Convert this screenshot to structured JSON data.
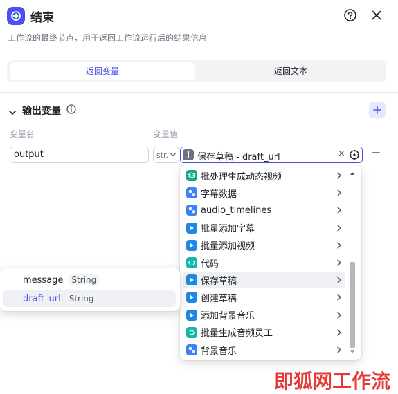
{
  "header": {
    "title": "结束",
    "subtitle": "工作流的最终节点，用于返回工作流运行后的结果信息",
    "accent": "#4d53e8"
  },
  "tabs": [
    {
      "label": "返回变量",
      "active": true
    },
    {
      "label": "返回文本",
      "active": false
    }
  ],
  "output_section": {
    "title": "输出变量",
    "col_name_label": "变量名",
    "col_value_label": "变量值",
    "row": {
      "name_value": "output",
      "type_value": "str.",
      "ref_value": "保存草稿 - draft_url"
    }
  },
  "dropdown": {
    "items": [
      {
        "label": "批处理生成动态视频",
        "icon": "layers-icon",
        "color": "#13a88a"
      },
      {
        "label": "字幕数据",
        "icon": "plugin-icon",
        "color": "#3b82f6"
      },
      {
        "label": "audio_timelines",
        "icon": "plugin-icon",
        "color": "#3b82f6"
      },
      {
        "label": "批量添加字幕",
        "icon": "play-icon",
        "color": "#1e88e5"
      },
      {
        "label": "批量添加视频",
        "icon": "play-icon",
        "color": "#1e88e5"
      },
      {
        "label": "代码",
        "icon": "code-icon",
        "color": "#14b8a6"
      },
      {
        "label": "保存草稿",
        "icon": "play-icon",
        "color": "#1e88e5",
        "active": true
      },
      {
        "label": "创建草稿",
        "icon": "play-icon",
        "color": "#1e88e5"
      },
      {
        "label": "添加背景音乐",
        "icon": "play-icon",
        "color": "#1e88e5"
      },
      {
        "label": "批量生成音频员工",
        "icon": "loop-icon",
        "color": "#14b8a6"
      },
      {
        "label": "背景音乐",
        "icon": "plugin-icon",
        "color": "#3b82f6"
      }
    ]
  },
  "variable_popup": {
    "items": [
      {
        "name": "message",
        "type": "String"
      },
      {
        "name": "draft_url",
        "type": "String",
        "active": true
      }
    ]
  },
  "watermark": "即狐网工作流"
}
